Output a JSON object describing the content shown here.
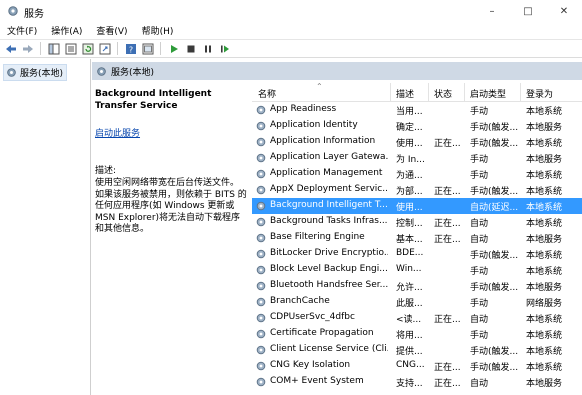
{
  "window": {
    "title": "服务"
  },
  "menu": [
    "文件(F)",
    "操作(A)",
    "查看(V)",
    "帮助(H)"
  ],
  "tree": {
    "item": "服务(本地)"
  },
  "pane": {
    "header": "服务(本地)"
  },
  "description": {
    "title": "Background Intelligent Transfer Service",
    "link": "启动此服务",
    "label": "描述:",
    "body": "使用空闲网络带宽在后台传送文件。如果该服务被禁用，则依赖于 BITS 的任何应用程序(如 Windows 更新或 MSN Explorer)将无法自动下载程序和其他信息。"
  },
  "columns": [
    "名称",
    "描述",
    "状态",
    "启动类型",
    "登录为"
  ],
  "rows": [
    [
      "App Readiness",
      "当用...",
      "",
      "手动",
      "本地系统"
    ],
    [
      "Application Identity",
      "确定...",
      "",
      "手动(触发...",
      "本地服务"
    ],
    [
      "Application Information",
      "使用...",
      "正在...",
      "手动(触发...",
      "本地系统"
    ],
    [
      "Application Layer Gatewa...",
      "为 In...",
      "",
      "手动",
      "本地服务"
    ],
    [
      "Application Management",
      "为通...",
      "",
      "手动",
      "本地系统"
    ],
    [
      "AppX Deployment Servic...",
      "为部...",
      "正在...",
      "手动(触发...",
      "本地系统"
    ],
    [
      "Background Intelligent T...",
      "使用...",
      "",
      "自动(延迟...",
      "本地系统"
    ],
    [
      "Background Tasks Infras...",
      "控制...",
      "正在...",
      "自动",
      "本地系统"
    ],
    [
      "Base Filtering Engine",
      "基本...",
      "正在...",
      "自动",
      "本地服务"
    ],
    [
      "BitLocker Drive Encryptio...",
      "BDE...",
      "",
      "手动(触发...",
      "本地系统"
    ],
    [
      "Block Level Backup Engi...",
      "Win...",
      "",
      "手动",
      "本地系统"
    ],
    [
      "Bluetooth Handsfree Ser...",
      "允许...",
      "",
      "手动(触发...",
      "本地服务"
    ],
    [
      "BranchCache",
      "此服...",
      "",
      "手动",
      "网络服务"
    ],
    [
      "CDPUserSvc_4dfbc",
      "<读...",
      "正在...",
      "自动",
      "本地系统"
    ],
    [
      "Certificate Propagation",
      "将用...",
      "",
      "手动",
      "本地系统"
    ],
    [
      "Client License Service (Cli...",
      "提供...",
      "",
      "手动(触发...",
      "本地系统"
    ],
    [
      "CNG Key Isolation",
      "CNG...",
      "正在...",
      "手动(触发...",
      "本地系统"
    ],
    [
      "COM+ Event System",
      "支持...",
      "正在...",
      "自动",
      "本地服务"
    ]
  ],
  "selected_row": 6
}
